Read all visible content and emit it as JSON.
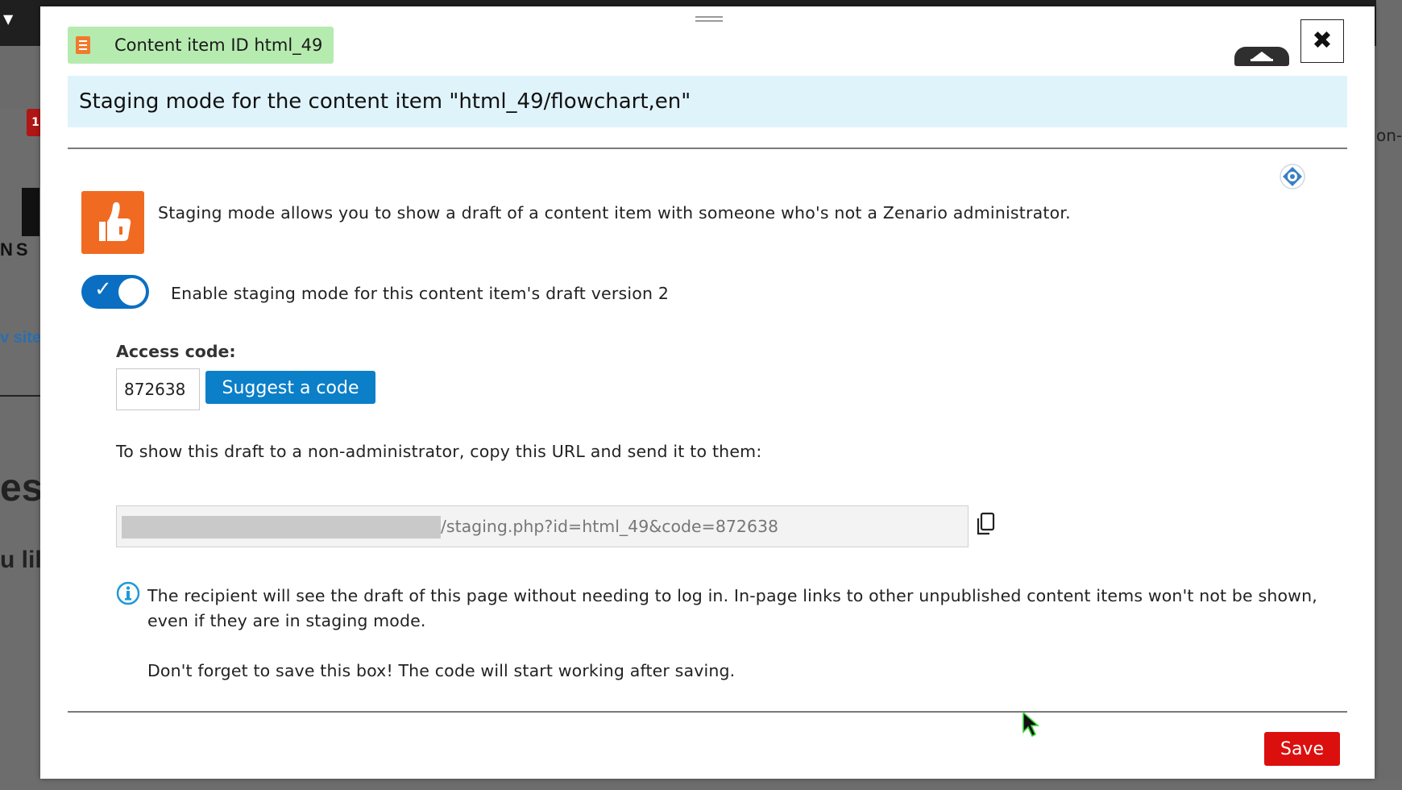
{
  "modal": {
    "badge_label": "Content item ID  html_49",
    "title": "Staging mode for the content item \"html_49/flowchart,en\"",
    "close_glyph": "✖",
    "intro_text": "Staging mode allows you to show a draft of a content item with someone who's not a Zenario administrator.",
    "toggle": {
      "label": "Enable staging mode for this content item's draft version 2",
      "checked": true
    },
    "access_code": {
      "label": "Access code:",
      "value": "872638"
    },
    "suggest_button": "Suggest a code",
    "url_intro": "To show this draft to a non-administrator, copy this URL and send it to them:",
    "url_suffix": "/staging.php?id=html_49&code=872638",
    "note_1": "The recipient will see the draft of this page without needing to log in. In-page links to other unpublished content items won't not be shown, even if they are in staging mode.",
    "note_2": "Don't forget to save this box! The code will start working after saving.",
    "save_button": "Save"
  },
  "background": {
    "side_link": "v site",
    "logo_letters": "NS",
    "heading_fragment": "es",
    "text_fragment": "u lil",
    "right_fragment": "on-"
  },
  "icons": {
    "document": "document-icon",
    "collapse": "collapse-icon",
    "close": "close-icon",
    "help": "help-icon",
    "thumbs_up": "thumbs-up-icon",
    "copy": "copy-icon",
    "info": "info-icon",
    "cursor": "mouse-cursor"
  },
  "colors": {
    "badge_bg": "#b6ebb0",
    "title_bg": "#dff3fb",
    "primary_blue": "#0b7fc8",
    "toggle_blue": "#0a6fc2",
    "thumb_orange": "#f16a21",
    "save_red": "#dc0f0f"
  }
}
